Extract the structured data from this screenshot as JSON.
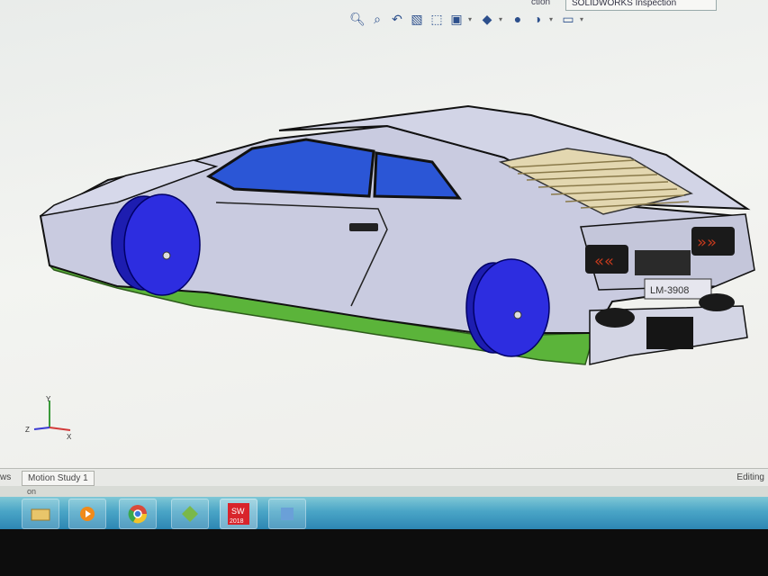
{
  "toolbar": {
    "inspection_tab": "SOLIDWORKS Inspection",
    "left_tab": "ction",
    "icons": [
      "zoom-to-fit-icon",
      "zoom-area-icon",
      "previous-view-icon",
      "section-view-icon",
      "view-orientation-icon",
      "display-style-icon",
      "hide-show-icon",
      "edit-appearance-icon",
      "apply-scene-icon",
      "view-settings-icon",
      "monitor-icon"
    ]
  },
  "car": {
    "badge_text": "LM-3908",
    "colors": {
      "body": "#c9cbe0",
      "glass": "#2b56d6",
      "wheels": "#2d2de0",
      "skirt": "#5bb43a",
      "taillight": "#c43a1d"
    }
  },
  "triad": {
    "x_label": "X",
    "y_label": "Y",
    "z_label": "Z"
  },
  "status": {
    "left_tab": "ws",
    "motion_tab": "Motion Study 1",
    "right_text": "Editing",
    "second_line": "on"
  },
  "taskbar": {
    "items": [
      "file-explorer-icon",
      "media-player-icon",
      "chrome-icon",
      "app-icon",
      "solidworks-icon",
      "app-icon-2"
    ],
    "sw_badge_top": "SW",
    "sw_badge_bottom": "2018"
  }
}
